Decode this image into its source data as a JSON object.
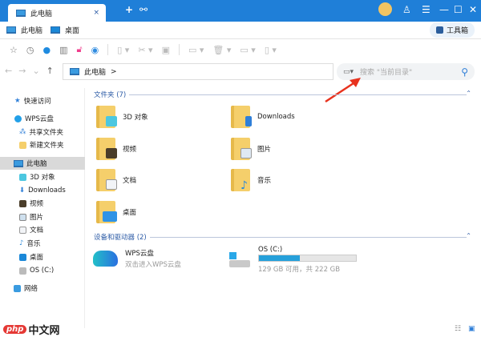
{
  "tab": {
    "title": "此电脑",
    "close": "×",
    "new": "+"
  },
  "bookmarks": [
    {
      "label": "此电脑"
    },
    {
      "label": "桌面"
    }
  ],
  "toolbox": "工具箱",
  "address": {
    "path": "此电脑",
    "sep": ">"
  },
  "search": {
    "placeholder": "搜索 \"当前目录\""
  },
  "sidebar": {
    "items": [
      "快速访问",
      "WPS云盘",
      "共享文件夹",
      "新建文件夹",
      "此电脑",
      "3D 对象",
      "Downloads",
      "视频",
      "图片",
      "文档",
      "音乐",
      "桌面",
      "OS (C:)",
      "网络"
    ]
  },
  "folders_header": "文件夹 (7)",
  "folders": [
    {
      "label": "3D 对象",
      "color": "#4cc7e0"
    },
    {
      "label": "Downloads",
      "color": "#2f7fd8"
    },
    {
      "label": "视频",
      "color": "#4a3d2a"
    },
    {
      "label": "图片",
      "color": "#dfe9f3"
    },
    {
      "label": "文档",
      "color": "#f2f4f7"
    },
    {
      "label": "音乐",
      "color": "#2c8ad8"
    },
    {
      "label": "桌面",
      "color": "#2f93e6"
    }
  ],
  "devices_header": "设备和驱动器 (2)",
  "devices": {
    "wps": {
      "name": "WPS云盘",
      "sub": "双击进入WPS云盘"
    },
    "drive": {
      "name": "OS (C:)",
      "free_text": "129 GB 可用，共 222 GB",
      "used_fraction": 0.42
    }
  },
  "watermark": "php中文网",
  "accent": "#1f7fd8"
}
